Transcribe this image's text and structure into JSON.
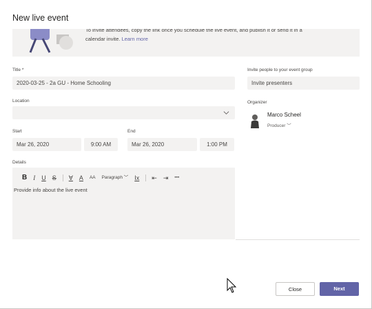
{
  "dialog": {
    "title": "New live event",
    "banner": {
      "line1": "To invite attendees, copy the link once you schedule the live event, and publish it or send it in a",
      "line2_prefix": "calendar invite.",
      "learn_more": "Learn more"
    }
  },
  "form": {
    "title_label": "Title *",
    "title_value": "2020-03-25 - 2a GU - Home Schooling",
    "location_label": "Location",
    "location_value": "",
    "start_label": "Start",
    "start_date": "Mar 26, 2020",
    "start_time": "9:00 AM",
    "end_label": "End",
    "end_date": "Mar 26, 2020",
    "end_time": "1:00 PM",
    "details_label": "Details",
    "details_placeholder": "Provide info about the live event",
    "toolbar": {
      "bold": "B",
      "italic": "I",
      "underline": "U",
      "strike": "S",
      "highlight": "∀",
      "font_color": "A",
      "font_size": "AA",
      "paragraph": "Paragraph",
      "clear_format": "Ix",
      "outdent": "⇤",
      "indent": "⇥",
      "more": "•••"
    }
  },
  "side": {
    "invite_label": "Invite people to your event group",
    "invite_placeholder": "Invite presenters",
    "organizer_label": "Organizer",
    "organizer_name": "Marco Scheel",
    "organizer_role": "Producer"
  },
  "footer": {
    "close_label": "Close",
    "next_label": "Next"
  },
  "colors": {
    "accent": "#6264a7",
    "field_bg": "#f3f2f1"
  }
}
